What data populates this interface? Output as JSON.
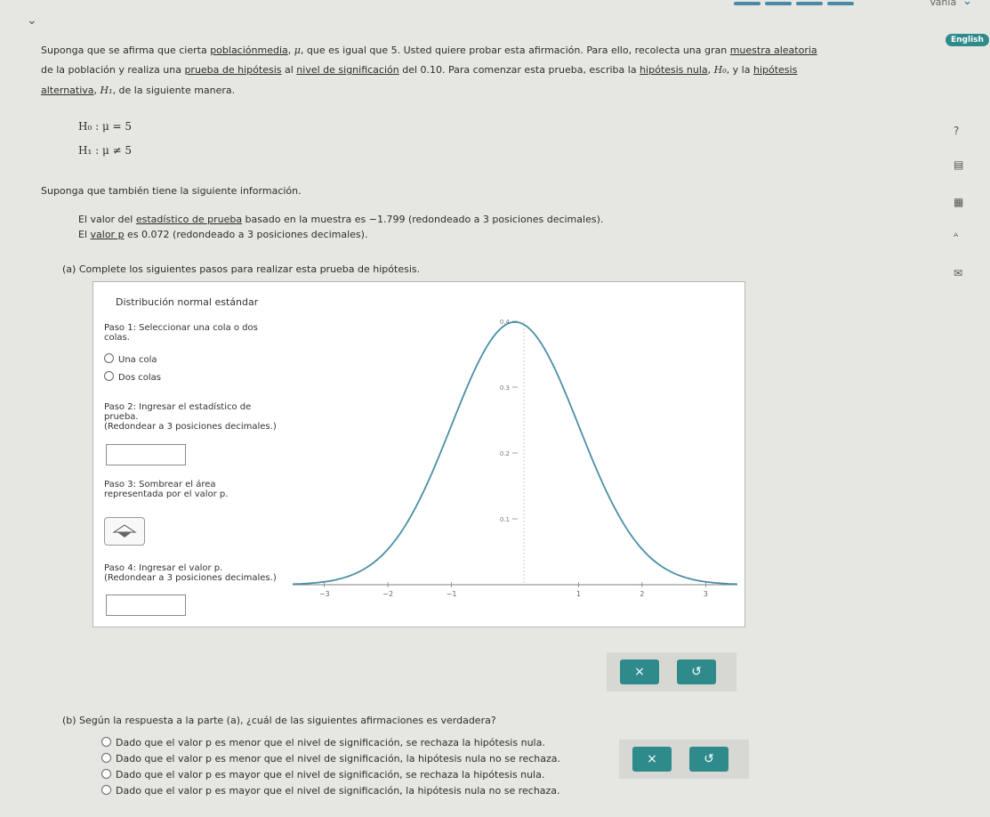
{
  "header": {
    "user_name": "Vania",
    "language_label": "English"
  },
  "problem": {
    "line1_before": "Suponga que se afirma que cierta ",
    "line1_link1": "poblaciónmedia",
    "line1_mid": ", ",
    "line1_mu": "μ",
    "line1_after": ", que es igual que 5. Usted quiere probar esta afirmación. Para ello, recolecta una gran ",
    "line1_link2": "muestra aleatoria",
    "line2_before": "de la población y realiza una ",
    "line2_link1": "prueba de hipótesis",
    "line2_mid1": " al ",
    "line2_link2": "nivel de significación",
    "line2_mid2": " del 0.10. Para comenzar esta prueba, escriba la ",
    "line2_link3": "hipótesis nula",
    "line2_mid3": ", ",
    "line2_h0": "H₀",
    "line2_mid4": ", y la ",
    "line2_link4": "hipótesis",
    "line3_link": "alternativa",
    "line3_mid": ", ",
    "line3_h1": "H₁",
    "line3_after": ", de la siguiente manera.",
    "h0": "H₀ : μ = 5",
    "h1": "H₁ : μ ≠ 5",
    "info_intro": "Suponga que también tiene la siguiente información.",
    "info1_before": "El valor del ",
    "info1_link": "estadístico de prueba",
    "info1_after": " basado en la muestra es −1.799 (redondeado a 3 posiciones decimales).",
    "info2_before": "El ",
    "info2_link": "valor p",
    "info2_after": " es 0.072 (redondeado a 3 posiciones decimales).",
    "part_a": "(a) Complete los siguientes pasos para realizar esta prueba de hipótesis."
  },
  "panel": {
    "title": "Distribución normal estándar",
    "step1_line1": "Paso 1: Seleccionar una cola o dos",
    "step1_line2": "colas.",
    "option_one_tail": "Una cola",
    "option_two_tail": "Dos colas",
    "step2_line1": "Paso 2: Ingresar el estadístico de",
    "step2_line2": "prueba.",
    "step2_line3": "(Redondear a 3 posiciones decimales.)",
    "step3_line1": "Paso 3: Sombrear el área",
    "step3_line2": "representada por el valor p.",
    "step4_line1": "Paso 4: Ingresar el valor p.",
    "step4_line2": "(Redondear a 3 posiciones decimales.)"
  },
  "chart_data": {
    "type": "line",
    "title": "",
    "xlabel": "",
    "ylabel": "",
    "x_ticks": [
      "−3",
      "−2",
      "−1",
      "1",
      "2",
      "3"
    ],
    "y_ticks": [
      "0.1",
      "0.2",
      "0.3",
      "0.4"
    ],
    "xlim": [
      -3.5,
      3.5
    ],
    "ylim": [
      0,
      0.4
    ],
    "series": [
      {
        "values_description_function": "standard normal density",
        "x": [
          -3.5,
          -3,
          -2.5,
          -2,
          -1.5,
          -1,
          -0.5,
          0,
          0.5,
          1,
          1.5,
          2,
          2.5,
          3,
          3.5
        ],
        "y": [
          0.001,
          0.004,
          0.018,
          0.054,
          0.13,
          0.242,
          0.352,
          0.399,
          0.352,
          0.242,
          0.13,
          0.054,
          0.018,
          0.004,
          0.001
        ]
      }
    ],
    "color": "#4a8fa6"
  },
  "buttons": {
    "clear": "×",
    "undo": "↺"
  },
  "part_b": {
    "question": "(b) Según la respuesta a la parte (a), ¿cuál de las siguientes afirmaciones es verdadera?",
    "options": [
      "Dado que el valor p es menor que el nivel de significación, se rechaza la hipótesis nula.",
      "Dado que el valor p es menor que el nivel de significación, la hipótesis nula no se rechaza.",
      "Dado que el valor p es mayor que el nivel de significación, se rechaza la hipótesis nula.",
      "Dado que el valor p es mayor que el nivel de significación, la hipótesis nula no se rechaza."
    ]
  },
  "colors": {
    "teal": "#2f8a8c",
    "curve": "#4a8fa6"
  },
  "icons": [
    "chevron-down-icon",
    "help-icon",
    "calculator-icon",
    "table-icon",
    "glossary-icon",
    "mail-icon"
  ]
}
